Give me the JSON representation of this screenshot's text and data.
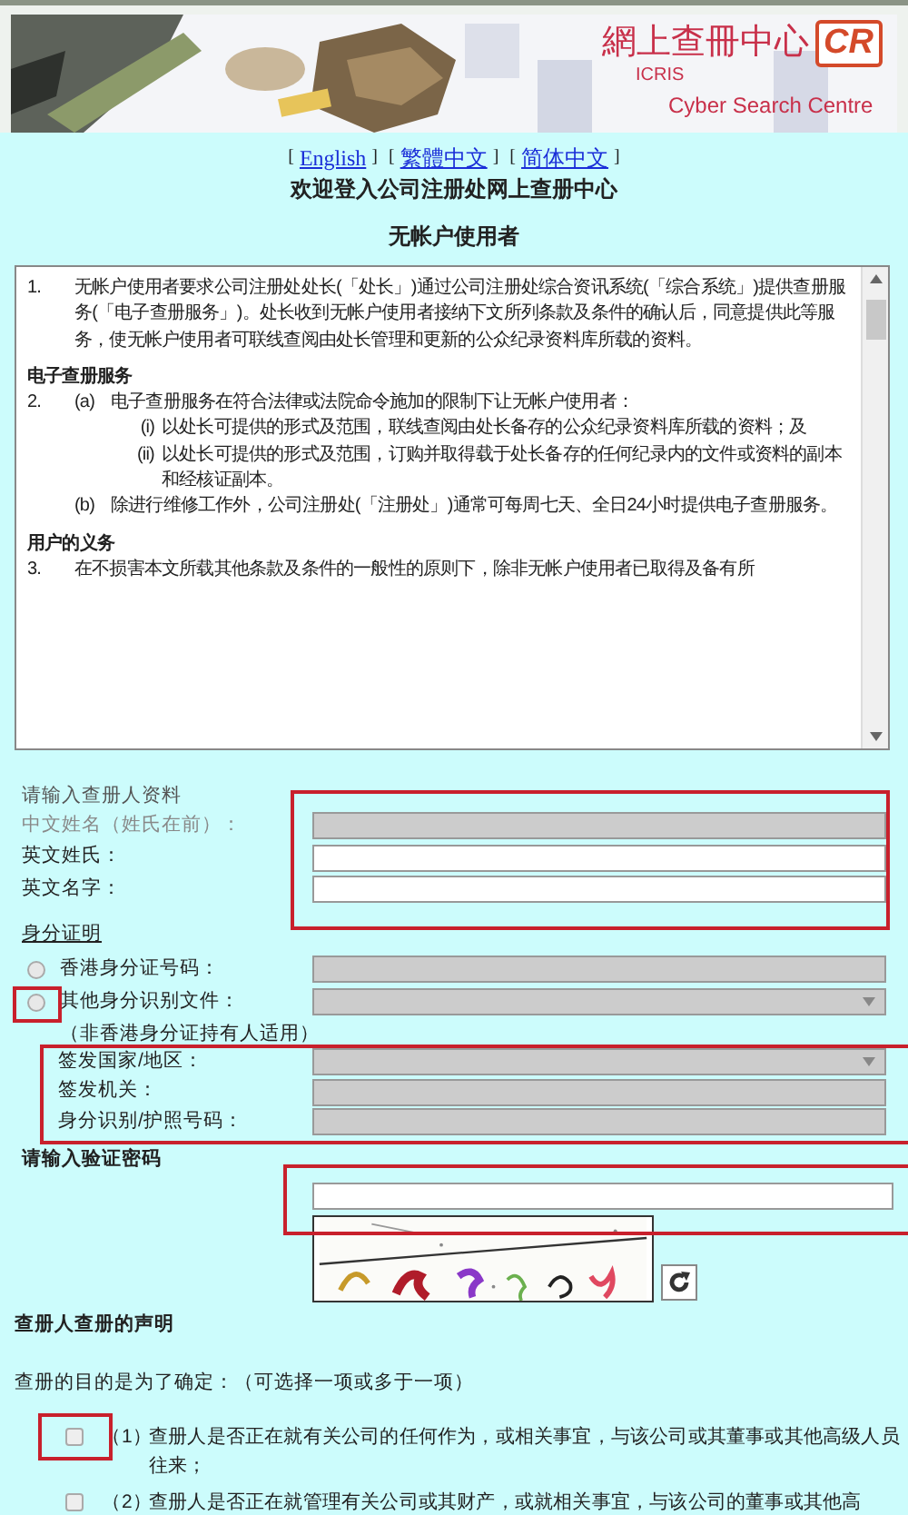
{
  "banner": {
    "logo_chinese": "網上查冊中心",
    "logo_badge": "CR",
    "logo_name": "ICRIS",
    "logo_tagline": "Cyber Search Centre"
  },
  "language_links": [
    {
      "open": "[",
      "label": "English",
      "close": "]"
    },
    {
      "open": "[",
      "label": "繁體中文",
      "close": "]"
    },
    {
      "open": "[",
      "label": "简体中文",
      "close": "]"
    }
  ],
  "title": "欢迎登入公司注册处网上查册中心",
  "subtitle": "无帐户使用者",
  "terms": [
    {
      "kind": "clause",
      "number": "1.",
      "text": "无帐户使用者要求公司注册处处长(「处长」)通过公司注册处综合资讯系统(「综合系统」)提供查册服务(「电子查册服务」)。处长收到无帐户使用者接纳下文所列条款及条件的确认后，同意提供此等服务，使无帐户使用者可联线查阅由处长管理和更新的公众纪录资料库所载的资料。"
    },
    {
      "kind": "heading",
      "text": "电子查册服务"
    },
    {
      "kind": "clause",
      "number": "2.",
      "items": [
        {
          "marker": "(a)",
          "text": "电子查册服务在符合法律或法院命令施加的限制下让无帐户使用者：",
          "items": [
            {
              "marker": "(i)",
              "text": "以处长可提供的形式及范围，联线查阅由处长备存的公众纪录资料库所载的资料；及"
            },
            {
              "marker": "(ii)",
              "text": "以处长可提供的形式及范围，订购并取得载于处长备存的任何纪录内的文件或资料的副本和经核证副本。"
            }
          ]
        },
        {
          "marker": "(b)",
          "text": "除进行维修工作外，公司注册处(「注册处」)通常可每周七天、全日24小时提供电子查册服务。"
        }
      ]
    },
    {
      "kind": "heading",
      "text": "用户的义务"
    },
    {
      "kind": "clause",
      "number": "3.",
      "text": "在不损害本文所载其他条款及条件的一般性的原则下，除非无帐户使用者已取得及备有所"
    }
  ],
  "requester": {
    "heading": "请输入查册人资料",
    "fields": [
      {
        "label": "中文姓名（姓氏在前）：",
        "disabled": true
      },
      {
        "label": "英文姓氏：",
        "disabled": false
      },
      {
        "label": "英文名字：",
        "disabled": false
      }
    ]
  },
  "identity": {
    "heading": "身分证明",
    "options": [
      {
        "label": "香港身分证号码：",
        "selected": false,
        "kind": "text",
        "disabled": true
      },
      {
        "label": "其他身分识别文件：",
        "selected": false,
        "kind": "select",
        "disabled": true,
        "note": "（非香港身分证持有人适用）"
      }
    ],
    "details": [
      {
        "label": "签发国家/地区：",
        "kind": "select",
        "disabled": true
      },
      {
        "label": "签发机关：",
        "kind": "text",
        "disabled": true
      },
      {
        "label": "身分识别/护照号码：",
        "kind": "text",
        "disabled": true
      }
    ]
  },
  "captcha": {
    "heading": "请输入验证密码"
  },
  "declaration": {
    "heading": "查册人查册的声明",
    "prompt": "查册的目的是为了确定：（可选择一项或多于一项）",
    "purposes": [
      {
        "number": "（1）",
        "text": "查册人是否正在就有关公司的任何作为，或相关事宜，与该公司或其董事或其他高级人员往来；",
        "checked": false
      },
      {
        "number": "（2）",
        "text": "查册人是否正在就管理有关公司或其财产，或就相关事宜，与该公司的董事或其他高",
        "checked": false
      }
    ]
  }
}
